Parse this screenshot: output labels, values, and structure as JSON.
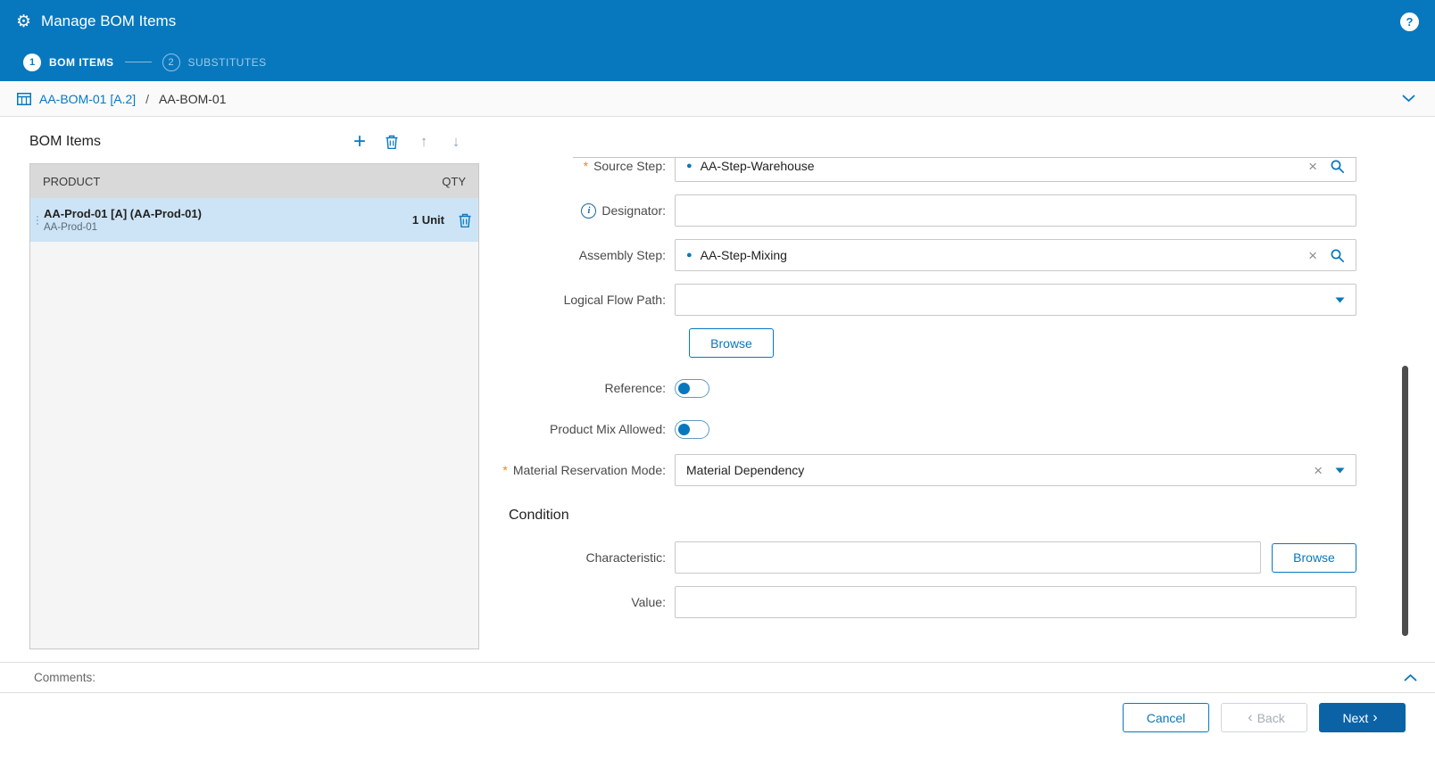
{
  "colors": {
    "primary": "#0878be",
    "selected_row": "#cde4f6",
    "list_header_bg": "#d9d9d9",
    "next_button": "#0b63a6",
    "required_marker": "#e8871e"
  },
  "icons": {
    "gear": "⚙",
    "help": "?",
    "plus": "+",
    "arrow_up": "↑",
    "arrow_down": "↓",
    "entity_dot": "●",
    "clear": "×",
    "info": "i",
    "back_chevron": "‹",
    "next_chevron": "›",
    "trash": "svg-trash",
    "search": "svg-magnifier",
    "dropdown": "svg-triangle-down",
    "chevron_down": "svg-chevron-down",
    "chevron_up": "svg-chevron-up",
    "table": "svg-table"
  },
  "header": {
    "title": "Manage BOM Items"
  },
  "stepper": {
    "steps": [
      {
        "number": "1",
        "label": "BOM ITEMS"
      },
      {
        "number": "2",
        "label": "SUBSTITUTES"
      }
    ]
  },
  "breadcrumb": {
    "link": "AA-BOM-01 [A.2]",
    "separator": "/",
    "current": "AA-BOM-01"
  },
  "bom_panel": {
    "title": "BOM Items",
    "columns": {
      "product": "PRODUCT",
      "qty": "QTY"
    },
    "rows": [
      {
        "name": "AA-Prod-01 [A] (AA-Prod-01)",
        "subtitle": "AA-Prod-01",
        "qty": "1 Unit"
      }
    ]
  },
  "form": {
    "required_marker": "*",
    "source_step": {
      "label": "Source Step:",
      "value": "AA-Step-Warehouse"
    },
    "designator": {
      "label": "Designator:",
      "value": ""
    },
    "assembly_step": {
      "label": "Assembly Step:",
      "value": "AA-Step-Mixing"
    },
    "logical_flow_path": {
      "label": "Logical Flow Path:",
      "value": ""
    },
    "browse_label": "Browse",
    "reference": {
      "label": "Reference:",
      "state": "off"
    },
    "product_mix_allowed": {
      "label": "Product Mix Allowed:",
      "state": "off"
    },
    "material_reservation_mode": {
      "label": "Material Reservation Mode:",
      "value": "Material Dependency"
    },
    "condition": {
      "title": "Condition",
      "characteristic": {
        "label": "Characteristic:",
        "value": ""
      },
      "browse_label": "Browse",
      "value_field": {
        "label": "Value:",
        "value": ""
      }
    }
  },
  "comments": {
    "label": "Comments:"
  },
  "footer": {
    "cancel_label": "Cancel",
    "back_label": "Back",
    "next_label": "Next"
  }
}
